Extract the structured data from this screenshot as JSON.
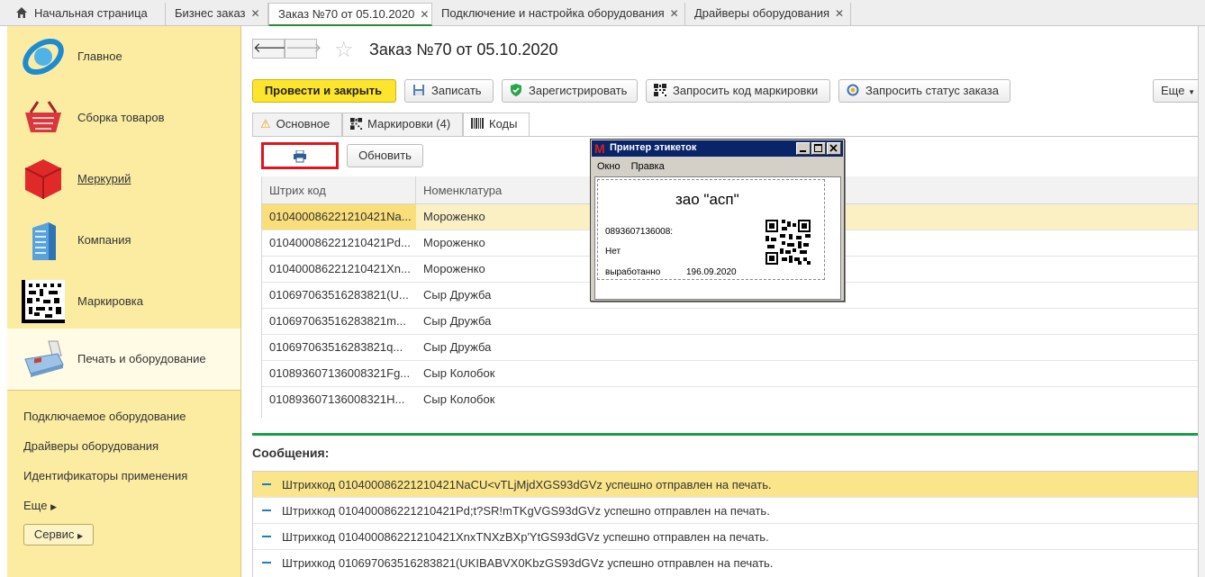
{
  "top_tabs": [
    {
      "label": "Начальная страница",
      "closable": false
    },
    {
      "label": "Бизнес заказ",
      "closable": true
    },
    {
      "label": "Заказ №70 от 05.10.2020",
      "closable": true,
      "active": true
    },
    {
      "label": "Подключение и настройка оборудования",
      "closable": true
    },
    {
      "label": "Драйверы оборудования",
      "closable": true
    }
  ],
  "sidebar": {
    "sections": [
      {
        "label": "Главное",
        "icon": "main-globe-icon"
      },
      {
        "label": "Сборка товаров",
        "icon": "basket-icon"
      },
      {
        "label": "Меркурий",
        "icon": "mercury-cube-icon"
      },
      {
        "label": "Компания",
        "icon": "building-icon"
      },
      {
        "label": "Маркировка",
        "icon": "datamatrix-icon"
      },
      {
        "label": "Печать и оборудование",
        "icon": "cash-register-icon",
        "active": true
      }
    ],
    "links": [
      "Подключаемое оборудование",
      "Драйверы оборудования",
      "Идентификаторы применения",
      "Еще"
    ],
    "service_label": "Сервис"
  },
  "doc": {
    "title": "Заказ №70 от 05.10.2020"
  },
  "toolbar": {
    "post_close": "Провести и закрыть",
    "save": "Записать",
    "register": "Зарегистрировать",
    "request_code": "Запросить код маркировки",
    "request_status": "Запросить статус заказа",
    "more": "Еще"
  },
  "form_tabs": [
    {
      "label": "Основное",
      "icon": "warning-icon"
    },
    {
      "label": "Маркировки (4)",
      "icon": "qr-icon"
    },
    {
      "label": "Коды",
      "icon": "barcode-icon",
      "active": true
    }
  ],
  "codes": {
    "refresh_label": "Обновить",
    "columns": [
      "Штрих код",
      "Номенклатура"
    ],
    "rows": [
      {
        "code": "010400086221210421Na...",
        "item": "Мороженко"
      },
      {
        "code": "010400086221210421Pd...",
        "item": "Мороженко"
      },
      {
        "code": "010400086221210421Xn...",
        "item": "Мороженко"
      },
      {
        "code": "010697063516283821(U...",
        "item": "Сыр Дружба"
      },
      {
        "code": "010697063516283821m...",
        "item": "Сыр Дружба"
      },
      {
        "code": "010697063516283821q...",
        "item": "Сыр Дружба"
      },
      {
        "code": "010893607136008321Fg...",
        "item": "Сыр Колобок"
      },
      {
        "code": "010893607136008321H...",
        "item": "Сыр Колобок"
      }
    ]
  },
  "messages": {
    "title": "Сообщения:",
    "items": [
      "Штрихкод 010400086221210421NaCU<vTLjMjdXGS93dGVz успешно отправлен на печать.",
      "Штрихкод 010400086221210421Pd;t?SR!mTKgVGS93dGVz успешно отправлен на печать.",
      "Штрихкод 010400086221210421XnxTNXzBXp'YtGS93dGVz успешно отправлен на печать.",
      "Штрихкод 010697063516283821(UKIBABVX0KbzGS93dGVz успешно отправлен на печать."
    ]
  },
  "popup": {
    "title": "Принтер этикеток",
    "menu": [
      "Окно",
      "Правка"
    ],
    "label": {
      "company": "зао \"асп\"",
      "code": "0893607136008:",
      "net": "Нет",
      "made": "выработанно",
      "date": "196.09.2020"
    }
  },
  "colors": {
    "sidebar_bg": "#fbeca2",
    "primary_button": "#fde52e",
    "accent_green": "#1f9b48",
    "selection": "#fbe58a",
    "highlight_red": "#e0141e",
    "popup_titlebar": "#0a246a"
  }
}
